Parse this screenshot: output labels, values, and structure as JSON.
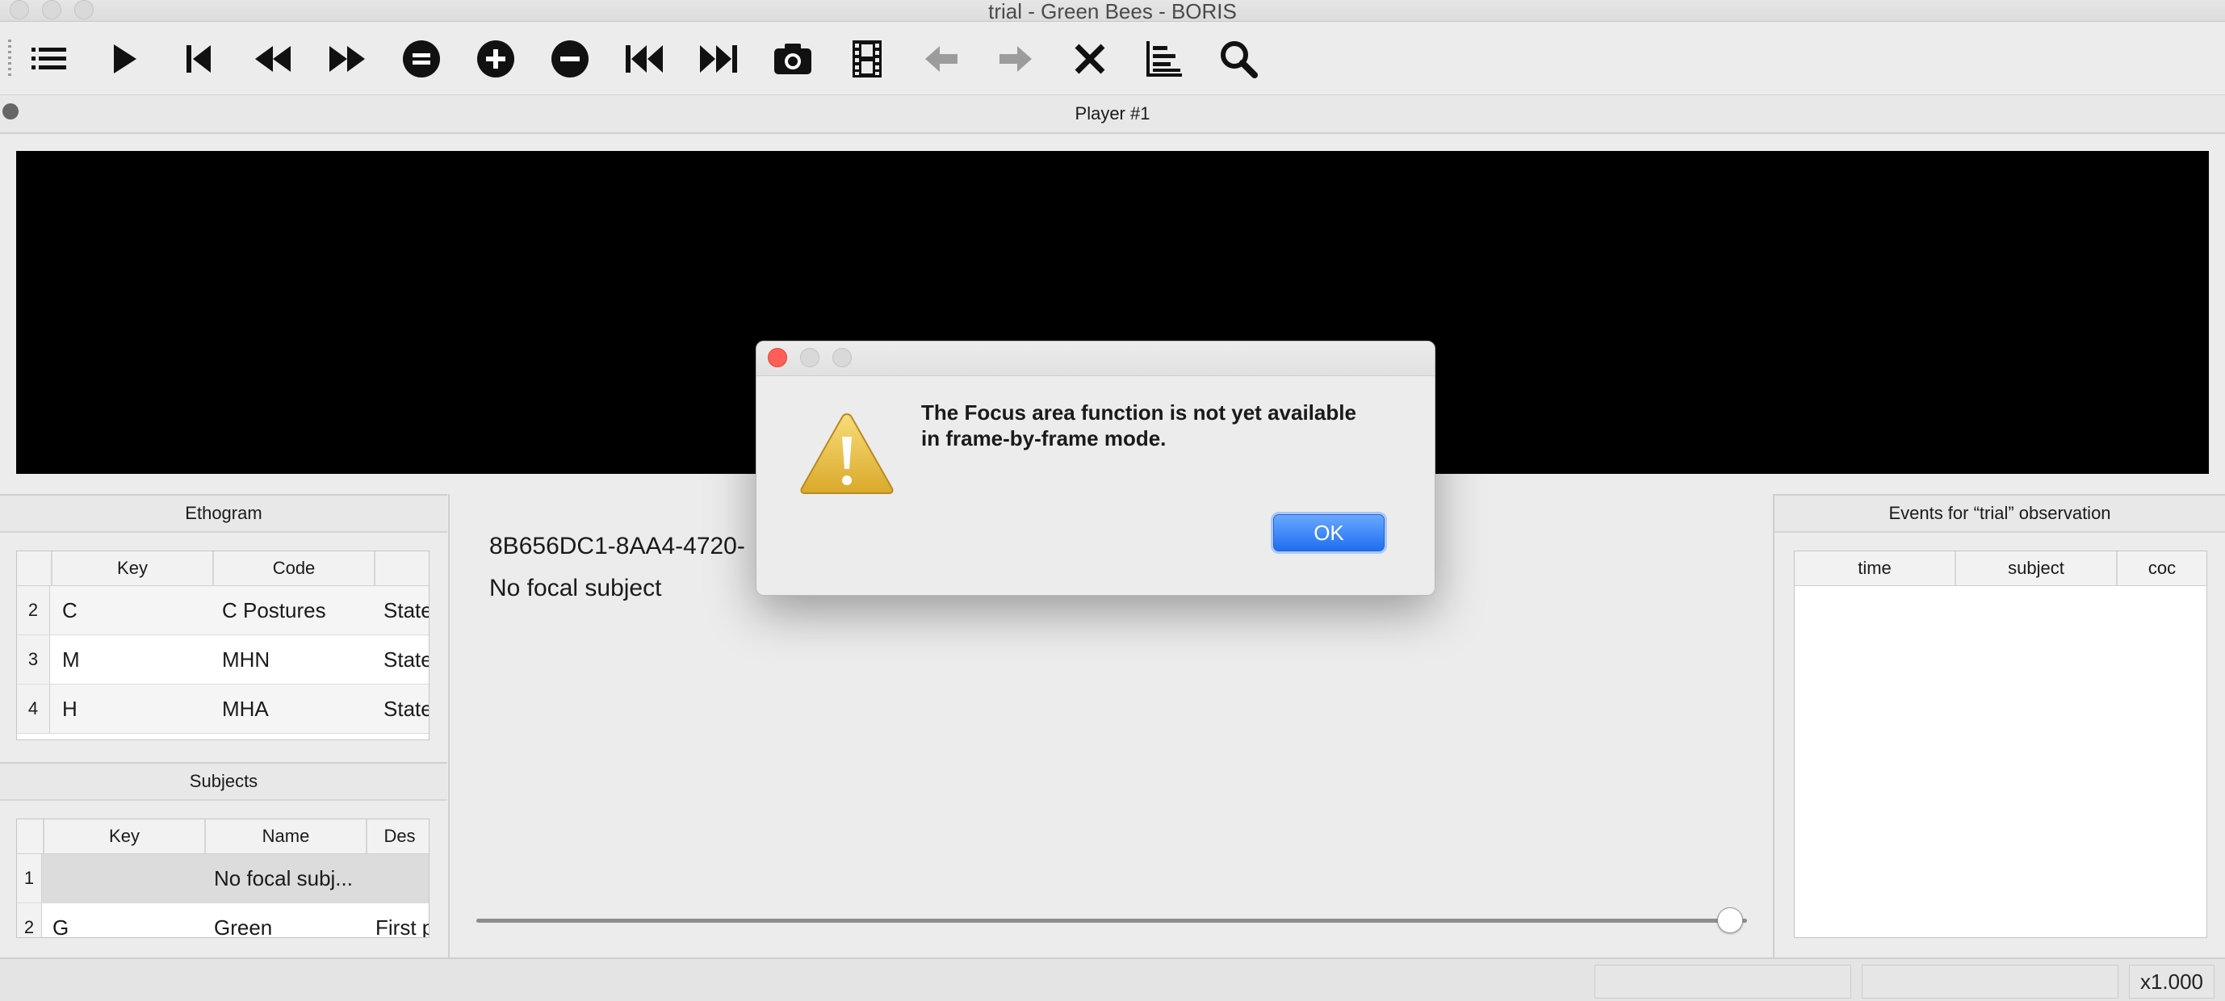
{
  "window": {
    "title": "trial - Green Bees - BORIS"
  },
  "toolbar": {
    "icons": [
      "list-icon",
      "play-icon",
      "previous-frame-icon",
      "rewind-icon",
      "fast-forward-icon",
      "equal-speed-icon",
      "increase-speed-icon",
      "decrease-speed-icon",
      "first-media-icon",
      "next-media-icon",
      "snapshot-icon",
      "video-frame-icon",
      "back-arrow-icon",
      "forward-arrow-icon",
      "close-icon",
      "chart-icon",
      "zoom-icon"
    ]
  },
  "player": {
    "title": "Player #1"
  },
  "ethogram": {
    "title": "Ethogram",
    "columns": [
      "Key",
      "Code",
      ""
    ],
    "rows": [
      {
        "num": "2",
        "key": "C",
        "code": "C Postures",
        "type": "State"
      },
      {
        "num": "3",
        "key": "M",
        "code": "MHN",
        "type": "State"
      },
      {
        "num": "4",
        "key": "H",
        "code": "MHA",
        "type": "State"
      }
    ]
  },
  "subjects": {
    "title": "Subjects",
    "columns": [
      "Key",
      "Name",
      "Des"
    ],
    "rows": [
      {
        "num": "1",
        "key": "",
        "name": "No focal subj...",
        "desc": ""
      },
      {
        "num": "2",
        "key": "G",
        "name": "Green",
        "desc": "First p"
      }
    ]
  },
  "center": {
    "media_id": "8B656DC1-8AA4-4720-",
    "focal": "No focal subject"
  },
  "events": {
    "title": "Events for “trial” observation",
    "columns": [
      "time",
      "subject",
      "coc"
    ]
  },
  "status": {
    "speed": "x1.000"
  },
  "dialog": {
    "line1": "The Focus area function is not yet available",
    "line2": "in frame-by-frame mode.",
    "ok_label": "OK"
  },
  "colors": {
    "accent": "#1f6ef0",
    "close": "#ff5f57"
  }
}
